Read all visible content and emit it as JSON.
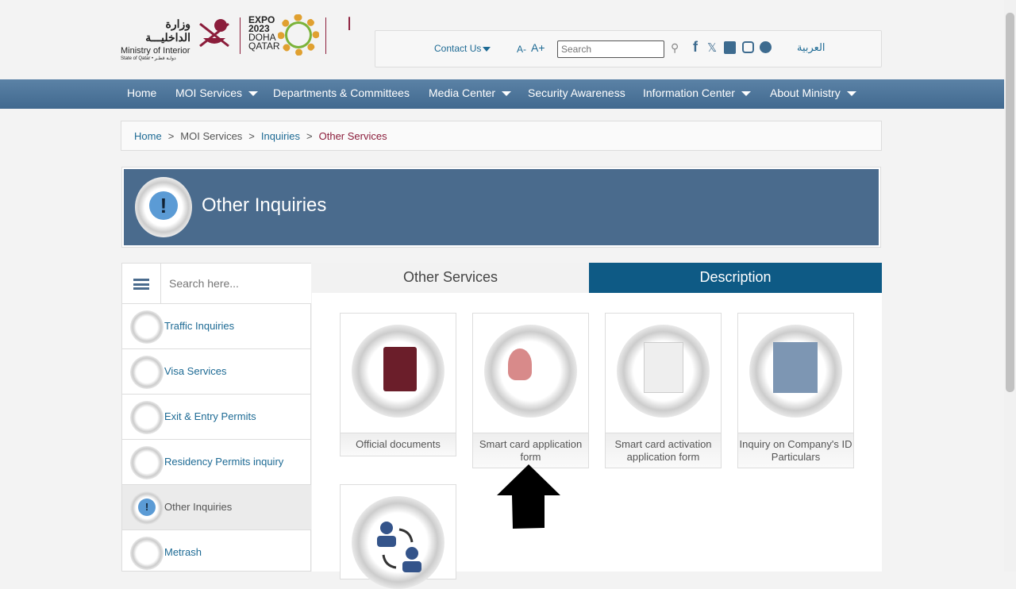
{
  "header": {
    "logo_ar": "وزارة الداخليـــة",
    "logo_en": "Ministry of Interior",
    "logo_sub": "State of Qatar • دولـة قطـر",
    "expo": [
      "EXPO",
      "2023",
      "DOHA",
      "QATAR"
    ],
    "contact": "Contact Us",
    "font_dec": "A-",
    "font_inc": "A+",
    "search_placeholder": "Search",
    "arabic": "العربية"
  },
  "nav": [
    "Home",
    "MOI Services",
    "Departments & Committees",
    "Media Center",
    "Security Awareness",
    "Information Center",
    "About Ministry"
  ],
  "breadcrumb": {
    "home": "Home",
    "services": "MOI Services",
    "inquiries": "Inquiries",
    "current": "Other Services"
  },
  "banner": {
    "title": "Other Inquiries"
  },
  "sidebar": {
    "search_placeholder": "Search here...",
    "items": [
      "Traffic Inquiries",
      "Visa Services",
      "Exit & Entry Permits",
      "Residency Permits inquiry",
      "Other Inquiries",
      "Metrash"
    ]
  },
  "tabs": {
    "other": "Other Services",
    "description": "Description"
  },
  "cards": [
    "Official documents",
    "Smart card application form",
    "Smart card activation application form",
    "Inquiry on Company's ID Particulars"
  ]
}
